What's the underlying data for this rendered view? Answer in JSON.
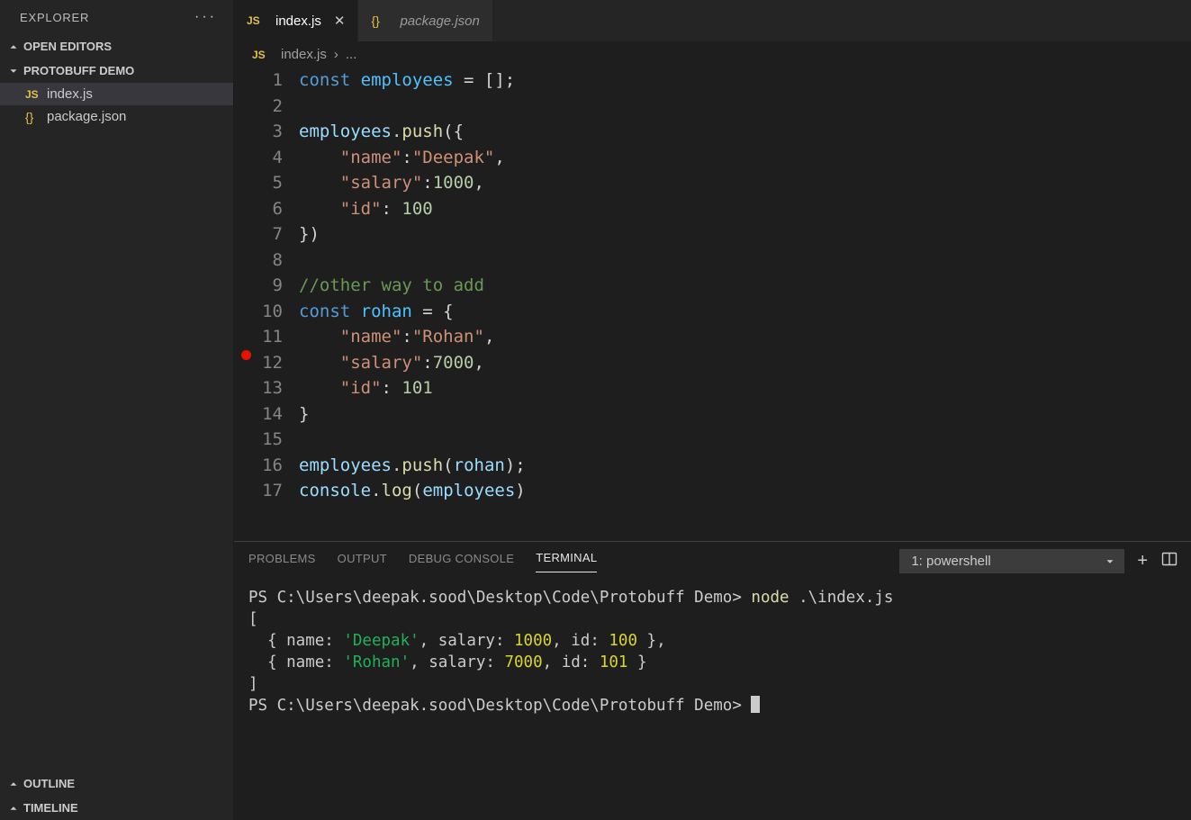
{
  "sidebar": {
    "title": "EXPLORER",
    "sections": {
      "open_editors": "OPEN EDITORS",
      "folder": "PROTOBUFF DEMO",
      "outline": "OUTLINE",
      "timeline": "TIMELINE"
    },
    "files": [
      {
        "icon": "JS",
        "name": "index.js",
        "active": true
      },
      {
        "icon": "{}",
        "name": "package.json",
        "active": false
      }
    ]
  },
  "tabs": [
    {
      "icon": "JS",
      "label": "index.js",
      "active": true,
      "closable": true
    },
    {
      "icon": "{}",
      "label": "package.json",
      "active": false,
      "closable": false
    }
  ],
  "breadcrumb": {
    "icon": "JS",
    "file": "index.js",
    "sep": "›",
    "rest": "..."
  },
  "code_lines": [
    {
      "n": 1,
      "bp": false,
      "tokens": [
        [
          "kw",
          "const "
        ],
        [
          "const",
          "employees"
        ],
        [
          "punc",
          " = [];"
        ]
      ]
    },
    {
      "n": 2,
      "bp": false,
      "tokens": []
    },
    {
      "n": 3,
      "bp": false,
      "tokens": [
        [
          "var",
          "employees"
        ],
        [
          "punc",
          "."
        ],
        [
          "fn",
          "push"
        ],
        [
          "punc",
          "({"
        ]
      ]
    },
    {
      "n": 4,
      "bp": false,
      "tokens": [
        [
          "punc",
          "    "
        ],
        [
          "str",
          "\"name\""
        ],
        [
          "punc",
          ":"
        ],
        [
          "str",
          "\"Deepak\""
        ],
        [
          "punc",
          ","
        ]
      ]
    },
    {
      "n": 5,
      "bp": false,
      "tokens": [
        [
          "punc",
          "    "
        ],
        [
          "str",
          "\"salary\""
        ],
        [
          "punc",
          ":"
        ],
        [
          "num",
          "1000"
        ],
        [
          "punc",
          ","
        ]
      ]
    },
    {
      "n": 6,
      "bp": false,
      "tokens": [
        [
          "punc",
          "    "
        ],
        [
          "str",
          "\"id\""
        ],
        [
          "punc",
          ": "
        ],
        [
          "num",
          "100"
        ]
      ]
    },
    {
      "n": 7,
      "bp": false,
      "tokens": [
        [
          "punc",
          "})"
        ]
      ]
    },
    {
      "n": 8,
      "bp": false,
      "tokens": []
    },
    {
      "n": 9,
      "bp": false,
      "tokens": [
        [
          "cmt",
          "//other way to add"
        ]
      ]
    },
    {
      "n": 10,
      "bp": false,
      "tokens": [
        [
          "kw",
          "const "
        ],
        [
          "const",
          "rohan"
        ],
        [
          "punc",
          " = {"
        ]
      ]
    },
    {
      "n": 11,
      "bp": false,
      "tokens": [
        [
          "punc",
          "    "
        ],
        [
          "str",
          "\"name\""
        ],
        [
          "punc",
          ":"
        ],
        [
          "str",
          "\"Rohan\""
        ],
        [
          "punc",
          ","
        ]
      ]
    },
    {
      "n": 12,
      "bp": true,
      "tokens": [
        [
          "punc",
          "    "
        ],
        [
          "str",
          "\"salary\""
        ],
        [
          "punc",
          ":"
        ],
        [
          "num",
          "7000"
        ],
        [
          "punc",
          ","
        ]
      ]
    },
    {
      "n": 13,
      "bp": false,
      "tokens": [
        [
          "punc",
          "    "
        ],
        [
          "str",
          "\"id\""
        ],
        [
          "punc",
          ": "
        ],
        [
          "num",
          "101"
        ]
      ]
    },
    {
      "n": 14,
      "bp": false,
      "tokens": [
        [
          "punc",
          "}"
        ]
      ]
    },
    {
      "n": 15,
      "bp": false,
      "tokens": []
    },
    {
      "n": 16,
      "bp": false,
      "tokens": [
        [
          "var",
          "employees"
        ],
        [
          "punc",
          "."
        ],
        [
          "fn",
          "push"
        ],
        [
          "punc",
          "("
        ],
        [
          "var",
          "rohan"
        ],
        [
          "punc",
          ");"
        ]
      ]
    },
    {
      "n": 17,
      "bp": false,
      "tokens": [
        [
          "var",
          "console"
        ],
        [
          "punc",
          "."
        ],
        [
          "fn",
          "log"
        ],
        [
          "punc",
          "("
        ],
        [
          "var",
          "employees"
        ],
        [
          "punc",
          ")"
        ]
      ]
    }
  ],
  "panel": {
    "tabs": [
      "PROBLEMS",
      "OUTPUT",
      "DEBUG CONSOLE",
      "TERMINAL"
    ],
    "active_tab": "TERMINAL",
    "term_select": "1: powershell",
    "terminal_lines": [
      [
        [
          "plain",
          "PS C:\\Users\\deepak.sood\\Desktop\\Code\\Protobuff Demo> "
        ],
        [
          "cmd",
          "node"
        ],
        [
          "plain",
          " .\\index.js"
        ]
      ],
      [
        [
          "plain",
          "["
        ]
      ],
      [
        [
          "plain",
          "  { name: "
        ],
        [
          "str",
          "'Deepak'"
        ],
        [
          "plain",
          ", salary: "
        ],
        [
          "num",
          "1000"
        ],
        [
          "plain",
          ", id: "
        ],
        [
          "num",
          "100"
        ],
        [
          "plain",
          " },"
        ]
      ],
      [
        [
          "plain",
          "  { name: "
        ],
        [
          "str",
          "'Rohan'"
        ],
        [
          "plain",
          ", salary: "
        ],
        [
          "num",
          "7000"
        ],
        [
          "plain",
          ", id: "
        ],
        [
          "num",
          "101"
        ],
        [
          "plain",
          " }"
        ]
      ],
      [
        [
          "plain",
          "]"
        ]
      ],
      [
        [
          "plain",
          "PS C:\\Users\\deepak.sood\\Desktop\\Code\\Protobuff Demo> "
        ],
        [
          "cursor",
          ""
        ]
      ]
    ]
  }
}
